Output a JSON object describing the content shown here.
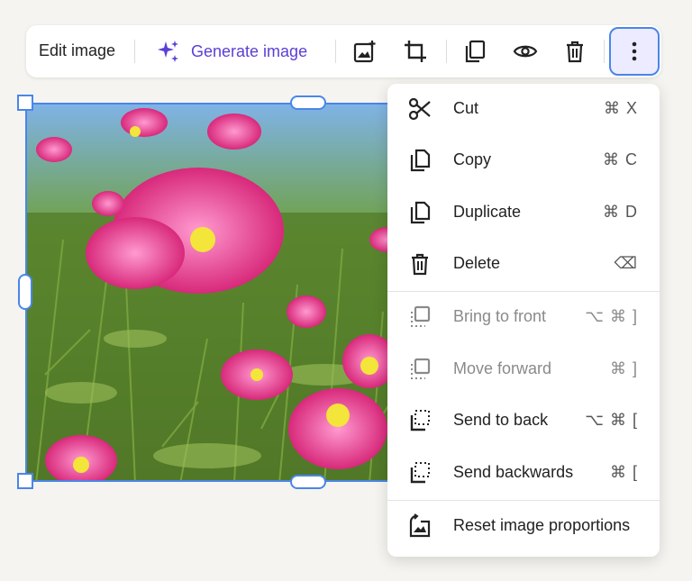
{
  "toolbar": {
    "edit_label": "Edit image",
    "generate_label": "Generate image",
    "accent_color": "#5b3fd6",
    "buttons": [
      {
        "name": "add-image-icon"
      },
      {
        "name": "crop-icon"
      },
      {
        "name": "duplicate-icon"
      },
      {
        "name": "eye-icon"
      },
      {
        "name": "trash-icon"
      },
      {
        "name": "more-vertical-icon"
      }
    ]
  },
  "image": {
    "subject_icon": "cosmos-flowers-photo",
    "selection_color": "#4a86e8"
  },
  "menu": {
    "items": [
      {
        "label": "Cut",
        "shortcut": "⌘ X",
        "icon": "scissors-icon"
      },
      {
        "label": "Copy",
        "shortcut": "⌘ C",
        "icon": "copy-icon"
      },
      {
        "label": "Duplicate",
        "shortcut": "⌘ D",
        "icon": "duplicate-icon"
      },
      {
        "label": "Delete",
        "shortcut": "⌫",
        "icon": "trash-icon"
      },
      {
        "label": "Bring to front",
        "shortcut": "⌥ ⌘ ]",
        "icon": "bring-to-front-icon",
        "disabled": true
      },
      {
        "label": "Move forward",
        "shortcut": "⌘ ]",
        "icon": "move-forward-icon",
        "disabled": true
      },
      {
        "label": "Send to back",
        "shortcut": "⌥ ⌘ [",
        "icon": "send-to-back-icon"
      },
      {
        "label": "Send backwards",
        "shortcut": "⌘ [",
        "icon": "send-backwards-icon"
      },
      {
        "label": "Reset image proportions",
        "shortcut": "",
        "icon": "reset-proportions-icon"
      }
    ]
  }
}
